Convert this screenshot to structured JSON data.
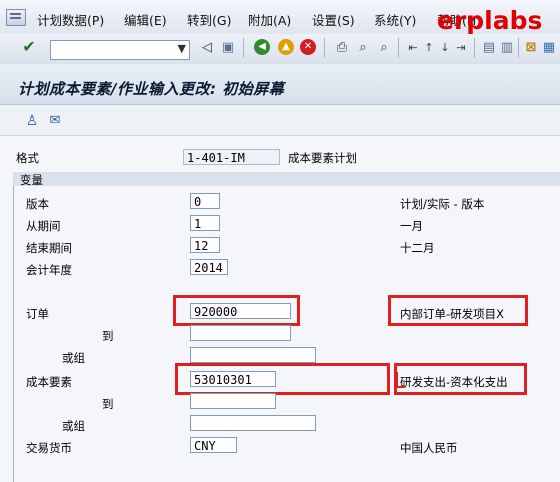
{
  "menu": {
    "items": [
      "计划数据(P)",
      "编辑(E)",
      "转到(G)",
      "附加(A)",
      "设置(S)",
      "系统(Y)",
      "帮助(H)"
    ],
    "brand": "erplabs"
  },
  "toolbar": {
    "command_value": "",
    "icons": [
      "enter-icon",
      "dropdown-icon",
      "back-arrow-icon",
      "save-icon",
      "back-icon",
      "exit-icon",
      "cancel-icon",
      "print-icon",
      "find-icon",
      "find-next-icon",
      "first-page-icon",
      "prev-page-icon",
      "next-page-icon",
      "last-page-icon",
      "new-session-icon",
      "shortcut-icon",
      "help-icon",
      "customize-icon"
    ]
  },
  "title": "计划成本要素/作业输入更改: 初始屏幕",
  "app_toolbar": {
    "icons": [
      "person-icon",
      "edit-layout-icon"
    ]
  },
  "format": {
    "label": "格式",
    "value": "1-401-IM",
    "desc": "成本要素计划"
  },
  "variables": {
    "title": "变量",
    "version": {
      "label": "版本",
      "value": "0",
      "desc": "计划/实际 - 版本"
    },
    "from_period": {
      "label": "从期间",
      "value": "1",
      "desc": "一月"
    },
    "to_period": {
      "label": "结束期间",
      "value": "12",
      "desc": "十二月"
    },
    "fiscal_year": {
      "label": "会计年度",
      "value": "2014"
    },
    "order": {
      "label": "订单",
      "value": "920000",
      "desc": "内部订单-研发项目X",
      "to_label": "到",
      "to_value": "",
      "group_label": "或组",
      "group_value": ""
    },
    "cost_element": {
      "label": "成本要素",
      "value": "53010301",
      "desc": "研发支出-资本化支出",
      "to_label": "到",
      "to_value": "",
      "group_label": "或组",
      "group_value": ""
    },
    "currency": {
      "label": "交易货币",
      "value": "CNY",
      "desc": "中国人民币"
    }
  },
  "colors": {
    "highlight": "#e02020",
    "brand": "#e00000"
  }
}
